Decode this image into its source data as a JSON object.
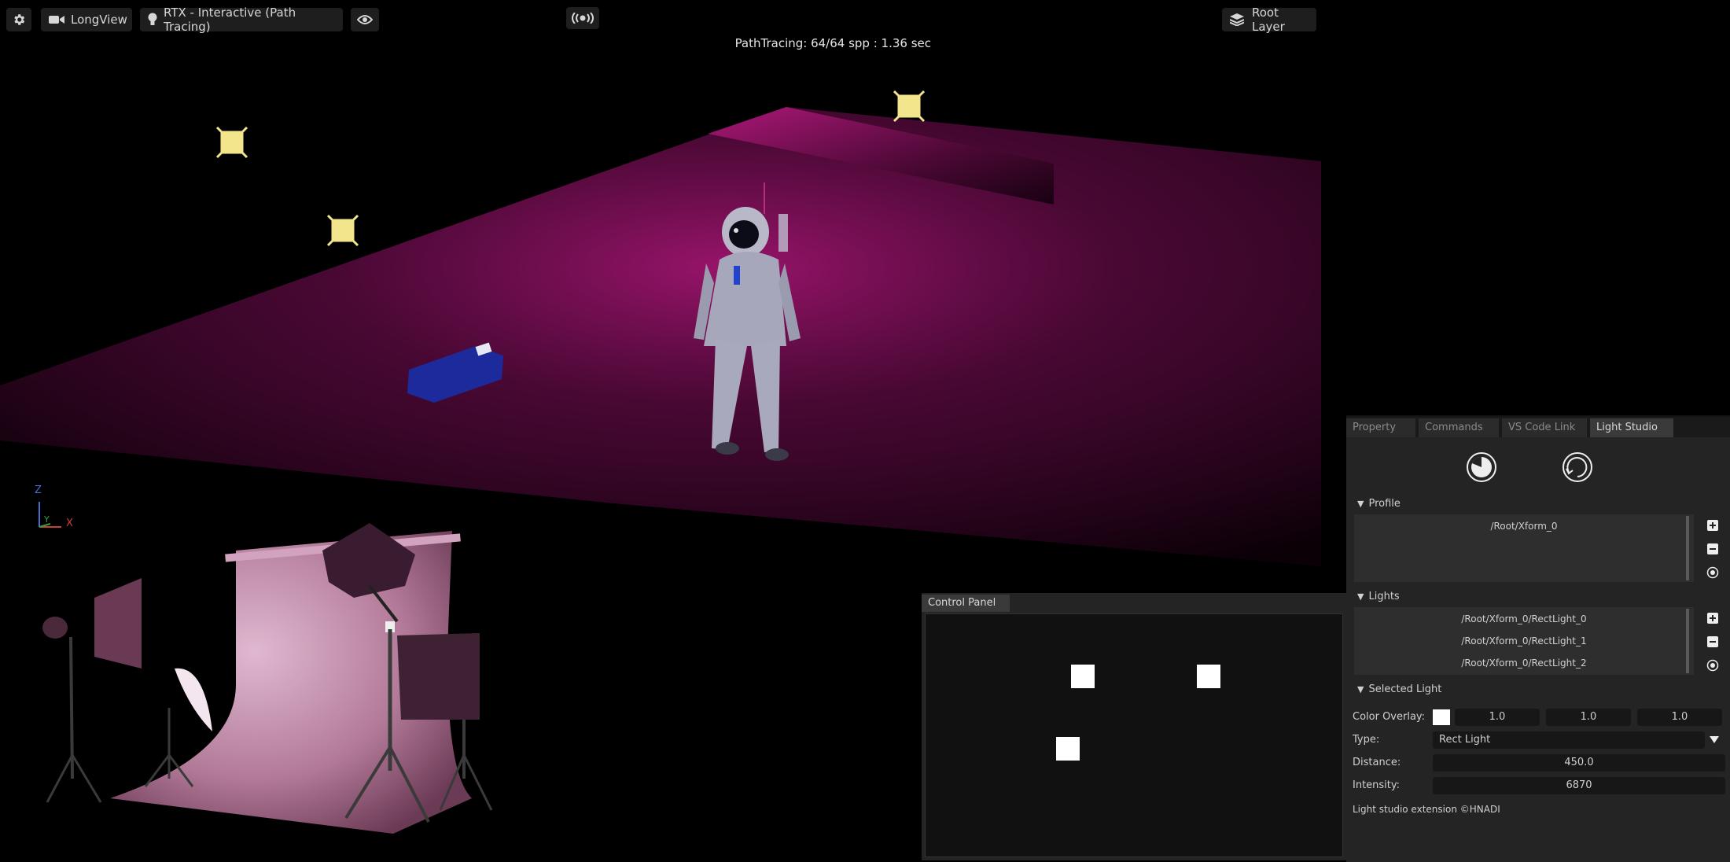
{
  "toolbar": {
    "settings_icon": "gear-icon",
    "camera": {
      "icon": "camera-icon",
      "label": "LongView"
    },
    "renderer": {
      "icon": "lightbulb-icon",
      "label": "RTX - Interactive (Path Tracing)"
    },
    "visibility_icon": "eye-icon",
    "live_sync_icon": "broadcast-icon",
    "layer": {
      "icon": "layers-icon",
      "label": "Root Layer"
    }
  },
  "viewport": {
    "stats": "PathTracing: 64/64 spp : 1.36 sec",
    "axis": {
      "z": "Z",
      "y": "Y",
      "x": "X"
    },
    "colors": {
      "floor_glow": "#d0208a",
      "light_gizmo": "#f3e58c"
    }
  },
  "right_panel": {
    "tabs": [
      {
        "label": "Property",
        "active": false
      },
      {
        "label": "Commands",
        "active": false
      },
      {
        "label": "VS Code Link",
        "active": false
      },
      {
        "label": "Light Studio",
        "active": true
      }
    ],
    "top_icons": [
      "dial-icon",
      "refresh-dial-icon"
    ],
    "profile": {
      "header": "Profile",
      "items": [
        "/Root/Xform_0"
      ],
      "actions": [
        "add-icon",
        "remove-icon",
        "target-icon"
      ]
    },
    "lights": {
      "header": "Lights",
      "items": [
        "/Root/Xform_0/RectLight_0",
        "/Root/Xform_0/RectLight_1",
        "/Root/Xform_0/RectLight_2"
      ],
      "actions": [
        "add-icon",
        "remove-icon",
        "target-icon"
      ]
    },
    "selected_light": {
      "header": "Selected Light",
      "color_overlay": {
        "label": "Color Overlay:",
        "swatch": "#ffffff",
        "r": "1.0",
        "g": "1.0",
        "b": "1.0"
      },
      "type": {
        "label": "Type:",
        "value": "Rect Light"
      },
      "distance": {
        "label": "Distance:",
        "value": "450.0"
      },
      "intensity": {
        "label": "Intensity:",
        "value": "6870"
      }
    },
    "footer": "Light studio extension ©HNADI"
  },
  "control_panel": {
    "tab": "Control Panel",
    "light_markers": 3
  }
}
